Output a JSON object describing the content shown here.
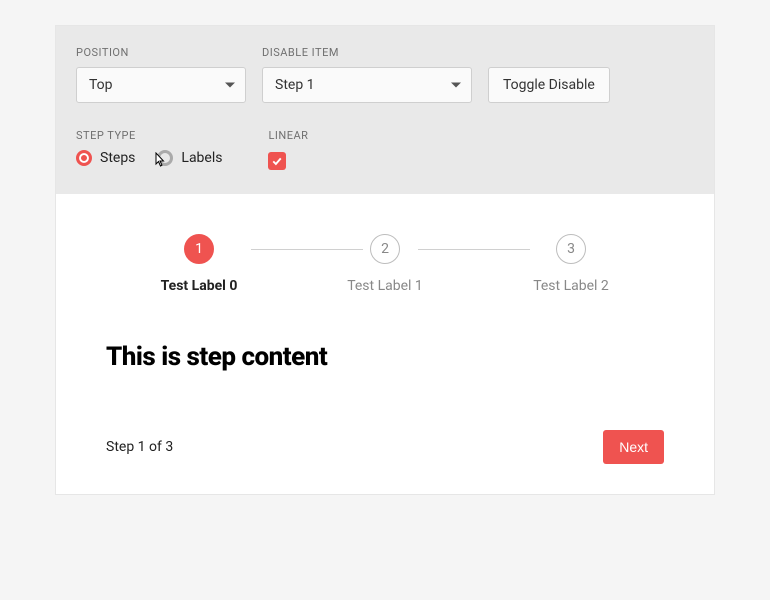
{
  "config": {
    "position": {
      "label": "POSITION",
      "value": "Top"
    },
    "disable_item": {
      "label": "DISABLE ITEM",
      "value": "Step 1"
    },
    "toggle_disable_label": "Toggle Disable",
    "step_type": {
      "label": "STEP TYPE",
      "options": {
        "steps": "Steps",
        "labels": "Labels"
      },
      "selected": "steps"
    },
    "linear": {
      "label": "LINEAR",
      "checked": true
    }
  },
  "stepper": {
    "steps": [
      {
        "num": "1",
        "label": "Test Label 0",
        "active": true
      },
      {
        "num": "2",
        "label": "Test Label 1",
        "active": false
      },
      {
        "num": "3",
        "label": "Test Label 2",
        "active": false
      }
    ]
  },
  "content": {
    "heading": "This is step content",
    "status": "Step 1 of 3",
    "next_label": "Next"
  },
  "colors": {
    "accent": "#ef5350"
  }
}
